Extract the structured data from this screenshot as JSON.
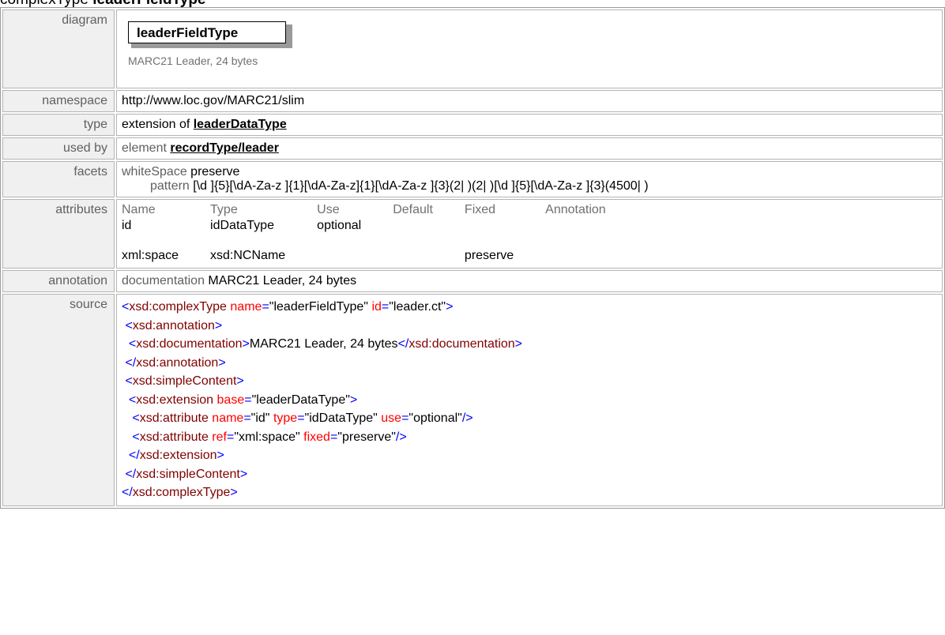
{
  "heading": {
    "prefix": "complexType",
    "name": "leaderFieldType"
  },
  "diagram": {
    "label": "diagram",
    "element_name": "leaderFieldType",
    "doc_text": "MARC21 Leader, 24 bytes"
  },
  "namespace": {
    "label": "namespace",
    "value": "http://www.loc.gov/MARC21/slim"
  },
  "type": {
    "label": "type",
    "prefix": "extension of",
    "link": "leaderDataType"
  },
  "used_by": {
    "label": "used by",
    "prefix": "element",
    "link": "recordType/leader"
  },
  "facets": {
    "label": "facets",
    "whitespace_key": "whiteSpace",
    "whitespace_value": "preserve",
    "pattern_key": "pattern",
    "pattern_value": "[\\d ]{5}[\\dA-Za-z ]{1}[\\dA-Za-z]{1}[\\dA-Za-z ]{3}(2| )(2| )[\\d ]{5}[\\dA-Za-z ]{3}(4500| )"
  },
  "attributes": {
    "label": "attributes",
    "headers": [
      "Name",
      "Type",
      "Use",
      "Default",
      "Fixed",
      "Annotation"
    ],
    "rows": [
      [
        "id",
        "idDataType",
        "optional",
        "",
        "",
        ""
      ],
      [
        "xml:space",
        "xsd:NCName",
        "",
        "",
        "preserve",
        ""
      ]
    ]
  },
  "annotation": {
    "label": "annotation",
    "key": "documentation",
    "value": "MARC21 Leader, 24 bytes"
  },
  "source": {
    "label": "source",
    "lines": {
      "l1_tag": "xsd:complexType",
      "l1_a1": "name",
      "l1_v1": "\"leaderFieldType\"",
      "l1_a2": "id",
      "l1_v2": "\"leader.ct\"",
      "l2_tag": "xsd:annotation",
      "l3_tag": "xsd:documentation",
      "l3_text": "MARC21 Leader, 24 bytes",
      "l3_close": "xsd:documentation",
      "l4_tag": "xsd:annotation",
      "l5_tag": "xsd:simpleContent",
      "l6_tag": "xsd:extension",
      "l6_a1": "base",
      "l6_v1": "\"leaderDataType\"",
      "l7_tag": "xsd:attribute",
      "l7_a1": "name",
      "l7_v1": "\"id\"",
      "l7_a2": "type",
      "l7_v2": "\"idDataType\"",
      "l7_a3": "use",
      "l7_v3": "\"optional\"",
      "l8_tag": "xsd:attribute",
      "l8_a1": "ref",
      "l8_v1": "\"xml:space\"",
      "l8_a2": "fixed",
      "l8_v2": "\"preserve\"",
      "l9_tag": "xsd:extension",
      "l10_tag": "xsd:simpleContent",
      "l11_tag": "xsd:complexType"
    }
  }
}
